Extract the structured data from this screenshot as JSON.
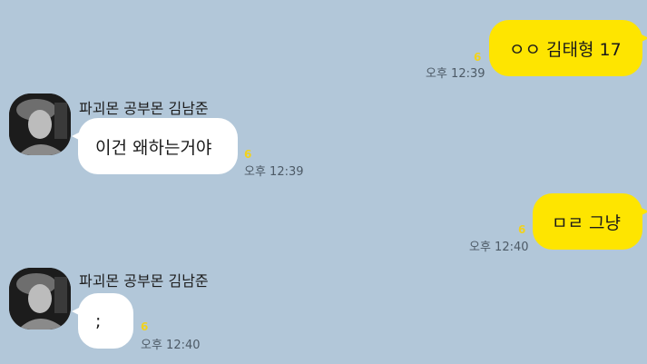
{
  "messages": [
    {
      "direction": "out",
      "text": "ㅇㅇ 김태형 17",
      "unread": "6",
      "time": "오후 12:39"
    },
    {
      "direction": "in",
      "sender": "파괴몬 공부몬 김남준",
      "text": "이건 왜하는거야",
      "unread": "6",
      "time": "오후 12:39"
    },
    {
      "direction": "out",
      "text": "ㅁㄹ 그냥",
      "unread": "6",
      "time": "오후 12:40"
    },
    {
      "direction": "in",
      "sender": "파괴몬 공부몬 김남준",
      "text": ";",
      "unread": "6",
      "time": "오후 12:40"
    }
  ],
  "colors": {
    "background": "#b2c7d9",
    "outgoing_bubble": "#fee500",
    "incoming_bubble": "#ffffff",
    "unread_count": "#f2d21b"
  },
  "icons": {
    "avatar": "profile-photo-avatar"
  }
}
